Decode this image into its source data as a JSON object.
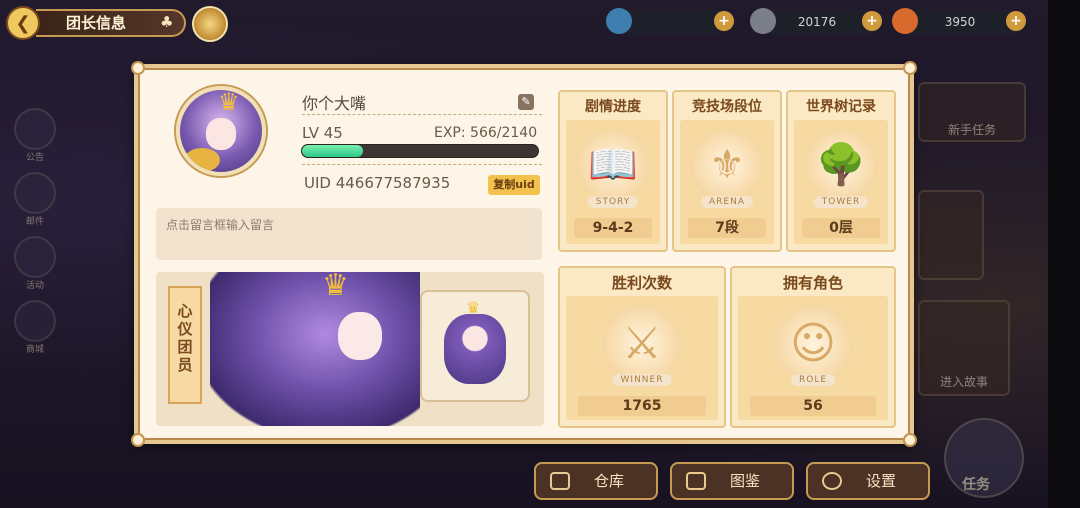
{
  "header": {
    "title": "团长信息",
    "resources": [
      {
        "name": "energy",
        "value": "",
        "icon": "leaf-icon"
      },
      {
        "name": "gems",
        "value": "20176",
        "icon": "gem-icon"
      },
      {
        "name": "carrots",
        "value": "3950",
        "icon": "carrot-icon"
      }
    ]
  },
  "profile": {
    "name": "你个大嘴",
    "level": "LV 45",
    "exp": "EXP: 566/2140",
    "exp_progress": 0.26,
    "uid": "UID 446677587935",
    "copy_label": "复制uid",
    "message_placeholder": "点击留言框输入留言",
    "showcase_banner": "心仪团员"
  },
  "stats": {
    "story": {
      "title": "剧情进度",
      "tag": "STORY",
      "value": "9-4-2"
    },
    "arena": {
      "title": "竞技场段位",
      "tag": "ARENA",
      "value": "7段"
    },
    "tower": {
      "title": "世界树记录",
      "tag": "TOWER",
      "value": "0层"
    },
    "wins": {
      "title": "胜利次数",
      "tag": "WINNER",
      "value": "1765"
    },
    "roles": {
      "title": "拥有角色",
      "tag": "ROLE",
      "value": "56"
    }
  },
  "bottom_bar": {
    "warehouse": "仓库",
    "collection": "图鉴",
    "settings": "设置"
  },
  "side_menu": [
    "公告",
    "邮件",
    "活动",
    "商城"
  ],
  "right_menu": {
    "newbie_task": "新手任务",
    "enter_story": "进入故事",
    "task": "任务"
  },
  "colors": {
    "panel_bg": "#fdf6e8",
    "accent_gold": "#e7c58a",
    "exp_bar": "#2cc888"
  }
}
